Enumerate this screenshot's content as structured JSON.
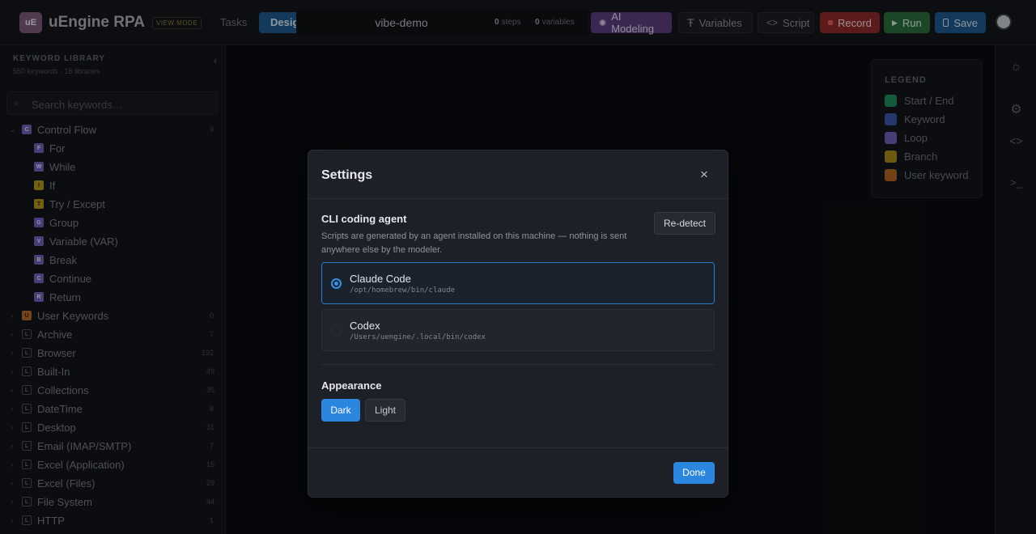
{
  "app": {
    "logo": "uE",
    "title": "uEngine RPA",
    "mode_badge": "VIEW MODE"
  },
  "tabs": {
    "tasks": "Tasks",
    "design": "Design"
  },
  "project": {
    "name": "vibe-demo",
    "steps_count": "0",
    "steps_label": "steps",
    "vars_count": "0",
    "vars_label": "variables"
  },
  "toolbar": {
    "ai": "AI Modeling",
    "variables": "Variables",
    "script": "Script",
    "record": "Record",
    "run": "Run",
    "save": "Save"
  },
  "sidebar": {
    "title": "KEYWORD LIBRARY",
    "subtitle": "550 keywords · 18 libraries",
    "search_placeholder": "Search keywords…",
    "groups": [
      {
        "badge": "C",
        "label": "Control Flow",
        "count": "9",
        "color": "#6f5fb2",
        "expanded": true
      },
      {
        "badge": "U",
        "label": "User Keywords",
        "count": "0",
        "color": "#b36a2a"
      },
      {
        "badge": "L",
        "label": "Archive",
        "count": "7"
      },
      {
        "badge": "L",
        "label": "Browser",
        "count": "192"
      },
      {
        "badge": "L",
        "label": "Built-In",
        "count": "49"
      },
      {
        "badge": "L",
        "label": "Collections",
        "count": "35"
      },
      {
        "badge": "L",
        "label": "DateTime",
        "count": "8"
      },
      {
        "badge": "L",
        "label": "Desktop",
        "count": "31"
      },
      {
        "badge": "L",
        "label": "Email (IMAP/SMTP)",
        "count": "7"
      },
      {
        "badge": "L",
        "label": "Excel (Application)",
        "count": "15"
      },
      {
        "badge": "L",
        "label": "Excel (Files)",
        "count": "29"
      },
      {
        "badge": "L",
        "label": "File System",
        "count": "44"
      },
      {
        "badge": "L",
        "label": "HTTP",
        "count": "1"
      }
    ],
    "control_items": [
      {
        "badge": "F",
        "label": "For",
        "color": "#6f5fb2"
      },
      {
        "badge": "W",
        "label": "While",
        "color": "#6f5fb2"
      },
      {
        "badge": "I",
        "label": "If",
        "color": "#b0951e"
      },
      {
        "badge": "T",
        "label": "Try / Except",
        "color": "#b0951e"
      },
      {
        "badge": "G",
        "label": "Group",
        "color": "#6f5fb2"
      },
      {
        "badge": "V",
        "label": "Variable (VAR)",
        "color": "#6f5fb2"
      },
      {
        "badge": "B",
        "label": "Break",
        "color": "#6f5fb2"
      },
      {
        "badge": "C",
        "label": "Continue",
        "color": "#6f5fb2"
      },
      {
        "badge": "R",
        "label": "Return",
        "color": "#6f5fb2"
      }
    ]
  },
  "legend": {
    "title": "LEGEND",
    "items": [
      {
        "label": "Start / End",
        "color": "#1f8a5e"
      },
      {
        "label": "Keyword",
        "color": "#3b55a8"
      },
      {
        "label": "Loop",
        "color": "#6f5fb2"
      },
      {
        "label": "Branch",
        "color": "#a88a1c"
      },
      {
        "label": "User keyword",
        "color": "#b0651f"
      }
    ]
  },
  "settings": {
    "title": "Settings",
    "cli_title": "CLI coding agent",
    "cli_desc": "Scripts are generated by an agent installed on this machine — nothing is sent anywhere else by the modeler.",
    "redetect": "Re-detect",
    "agents": [
      {
        "name": "Claude Code",
        "path": "/opt/homebrew/bin/claude",
        "selected": true
      },
      {
        "name": "Codex",
        "path": "/Users/uengine/.local/bin/codex",
        "selected": false
      }
    ],
    "appearance_title": "Appearance",
    "appearance_options": [
      "Dark",
      "Light"
    ],
    "appearance_selected": "Dark",
    "done": "Done"
  },
  "icons": {
    "ai": "sparkle-icon",
    "variables": "text-t-icon",
    "script": "code-brackets-icon",
    "record": "record-dot-icon",
    "run": "play-icon",
    "save": "floppy-disk-icon",
    "rail": [
      "sun-icon",
      "gear-icon",
      "code-icon",
      "terminal-icon"
    ]
  }
}
